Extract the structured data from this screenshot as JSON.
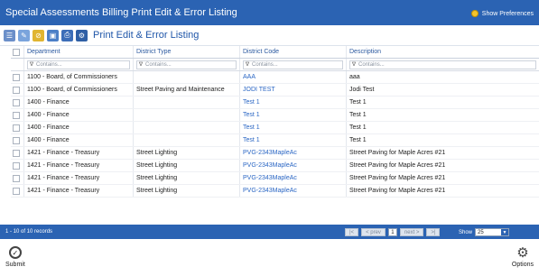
{
  "window": {
    "title": "Special Assessments Billing Print Edit & Error Listing",
    "preferences_label": "Show Preferences"
  },
  "toolbar": {
    "heading": "Print Edit & Error Listing",
    "icons": [
      "list-icon",
      "edit-icon",
      "filter-icon",
      "save-icon",
      "print-icon",
      "tools-icon"
    ]
  },
  "table": {
    "columns": [
      "Department",
      "District Type",
      "District Code",
      "Description"
    ],
    "filter_placeholder": "Contains...",
    "rows": [
      [
        "1100 - Board, of Commissioners",
        "",
        "AAA",
        "aaa"
      ],
      [
        "1100 - Board, of Commissioners",
        "Street Paving and Maintenance",
        "JODI TEST",
        "Jodi Test"
      ],
      [
        "1400 - Finance",
        "",
        "Test 1",
        "Test 1"
      ],
      [
        "1400 - Finance",
        "",
        "Test 1",
        "Test 1"
      ],
      [
        "1400 - Finance",
        "",
        "Test 1",
        "Test 1"
      ],
      [
        "1400 - Finance",
        "",
        "Test 1",
        "Test 1"
      ],
      [
        "1421 - Finance - Treasury",
        "Street Lighting",
        "PVG-2343MapleAc",
        "Street Paving for Maple Acres #21"
      ],
      [
        "1421 - Finance - Treasury",
        "Street Lighting",
        "PVG-2343MapleAc",
        "Street Paving for Maple Acres #21"
      ],
      [
        "1421 - Finance - Treasury",
        "Street Lighting",
        "PVG-2343MapleAc",
        "Street Paving for Maple Acres #21"
      ],
      [
        "1421 - Finance - Treasury",
        "Street Lighting",
        "PVG-2343MapleAc",
        "Street Paving for Maple Acres #21"
      ]
    ]
  },
  "footer": {
    "records": "1 - 10 of 10 records",
    "prev": "< prev",
    "page": "1",
    "next": "next >",
    "show_label": "Show",
    "page_size": "25"
  },
  "actions": {
    "submit": "Submit",
    "options": "Options"
  },
  "colors": {
    "header_blue": "#2b63b3",
    "link_blue": "#2a66c4"
  }
}
